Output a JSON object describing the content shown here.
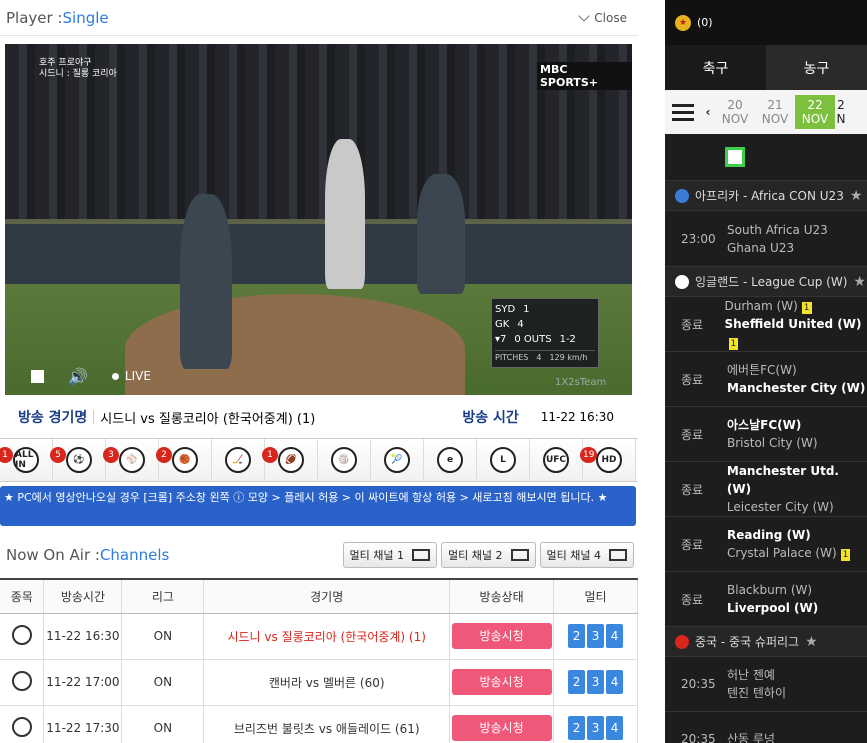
{
  "header": {
    "title_prefix": "Player : ",
    "title_mode": "Single",
    "close_label": "Close"
  },
  "player": {
    "overlay_top_left_1": "호주 프로야구",
    "overlay_top_left_2": "시드니 : 질롱 코리아",
    "broadcaster": "MBC SPORTS+",
    "score": {
      "team1": "SYD",
      "score1": "1",
      "team2": "GK",
      "score2": "4",
      "inning": "▾7",
      "outs": "0 OUTS",
      "count": "1-2",
      "pitches_label": "PITCHES",
      "pitches": "4",
      "speed": "129 km/h"
    },
    "live_label": "LIVE",
    "watermark": "1X2sTeam"
  },
  "info": {
    "game_label": "방송 경기명",
    "game_name": "시드니 vs 질롱코리아 (한국어중계) (1)",
    "time_label": "방송 시간",
    "time_value": "11-22 16:30"
  },
  "sports": [
    {
      "name": "all-in",
      "icon": "ALL IN",
      "badge": "1"
    },
    {
      "name": "soccer",
      "icon": "⚽",
      "badge": "5"
    },
    {
      "name": "baseball",
      "icon": "⚾",
      "badge": "3"
    },
    {
      "name": "basketball",
      "icon": "🏀",
      "badge": "2"
    },
    {
      "name": "hockey",
      "icon": "🏒",
      "badge": ""
    },
    {
      "name": "football",
      "icon": "🏈",
      "badge": "1"
    },
    {
      "name": "volleyball",
      "icon": "🏐",
      "badge": ""
    },
    {
      "name": "tennis",
      "icon": "🎾",
      "badge": ""
    },
    {
      "name": "esports",
      "icon": "e",
      "badge": ""
    },
    {
      "name": "lol",
      "icon": "L",
      "badge": ""
    },
    {
      "name": "ufc",
      "icon": "UFC",
      "badge": ""
    },
    {
      "name": "hd",
      "icon": "HD",
      "badge": "19"
    }
  ],
  "notice": "★ PC에서 영상안나오실 경우 [크롬] 주소창 왼쪽 ⓘ 모양 > 플레시 허용 > 이 싸이트에 항상 허용 > 새로고침 해보시면 됩니다. ★",
  "now_on_air": {
    "prefix": "Now On Air : ",
    "label": "Channels",
    "multi1": "멀티 채널 1",
    "multi2": "멀티 채널 2",
    "multi4": "멀티 채널 4"
  },
  "table": {
    "headers": [
      "종목",
      "방송시간",
      "리그",
      "경기명",
      "방송상태",
      "멀티"
    ],
    "rows": [
      {
        "time": "11-22 16:30",
        "league": "ON",
        "game": "시드니 vs 질롱코리아 (한국어중계) (1)",
        "status": "방송시청",
        "m": [
          "2",
          "3",
          "4"
        ]
      },
      {
        "time": "11-22 17:00",
        "league": "ON",
        "game": "캔버라 vs 멜버른 (60)",
        "status": "방송시청",
        "m": [
          "2",
          "3",
          "4"
        ]
      },
      {
        "time": "11-22 17:30",
        "league": "ON",
        "game": "브리즈번 불릿츠 vs 애들레이드 (61)",
        "status": "방송시청",
        "m": [
          "2",
          "3",
          "4"
        ]
      }
    ]
  },
  "right": {
    "coins": "(0)",
    "tabs": [
      "축구",
      "농구"
    ],
    "dates": [
      {
        "d": "20",
        "m": "NOV"
      },
      {
        "d": "21",
        "m": "NOV"
      },
      {
        "d": "22",
        "m": "NOV"
      },
      {
        "d": "2",
        "m": "N"
      }
    ],
    "leagues": [
      {
        "name": "아프리카 - Africa CON U23",
        "color": "#3a7bd5",
        "matches": [
          {
            "time": "23:00",
            "home": "South Africa U23",
            "away": "Ghana U23",
            "hb": "",
            "ab": "",
            "bold": ""
          }
        ]
      },
      {
        "name": "잉글랜드 - League Cup (W)",
        "color": "#ffffff",
        "matches": [
          {
            "time": "종료",
            "home": "Durham (W)",
            "away": "Sheffield United (W)",
            "hb": "1",
            "ab": "1",
            "bold": "away"
          },
          {
            "time": "종료",
            "home": "에버튼FC(W)",
            "away": "Manchester City (W)",
            "hb": "",
            "ab": "",
            "bold": "away"
          },
          {
            "time": "종료",
            "home": "아스날FC(W)",
            "away": "Bristol City (W)",
            "hb": "",
            "ab": "",
            "bold": "home"
          },
          {
            "time": "종료",
            "home": "Manchester Utd. (W)",
            "away": "Leicester City (W)",
            "hb": "",
            "ab": "",
            "bold": "home"
          },
          {
            "time": "종료",
            "home": "Reading (W)",
            "away": "Crystal Palace (W)",
            "hb": "",
            "ab": "1",
            "bold": "home"
          },
          {
            "time": "종료",
            "home": "Blackburn (W)",
            "away": "Liverpool (W)",
            "hb": "",
            "ab": "",
            "bold": "away"
          }
        ]
      },
      {
        "name": "중국 - 중국 슈퍼리그",
        "color": "#d9261c",
        "matches": [
          {
            "time": "20:35",
            "home": "허난 젠예",
            "away": "텐진 텐하이",
            "hb": "",
            "ab": "",
            "bold": ""
          },
          {
            "time": "20:35",
            "home": "산동 루넝",
            "away": "",
            "hb": "",
            "ab": "",
            "bold": ""
          }
        ]
      }
    ]
  }
}
